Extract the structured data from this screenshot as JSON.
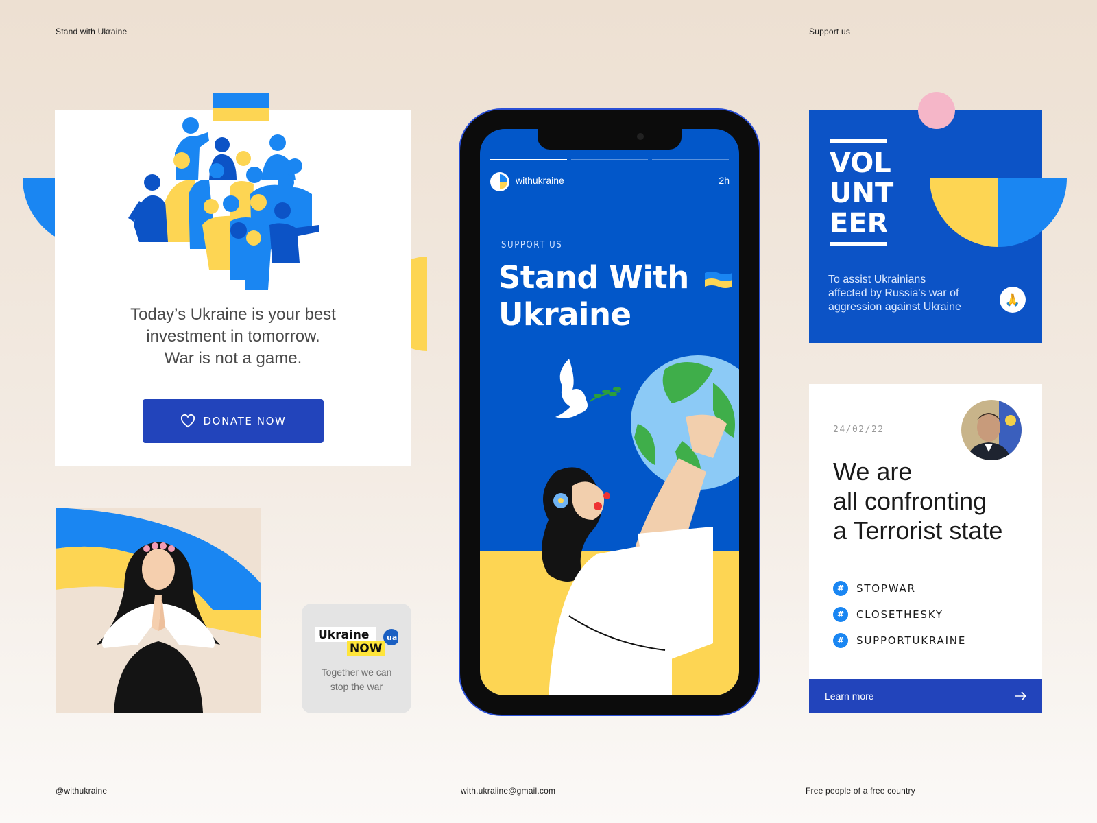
{
  "header": {
    "left": "Stand with Ukraine",
    "right": "Support us"
  },
  "footer": {
    "handle": "@withukraine",
    "email": "with.ukraiine@gmail.com",
    "motto": "Free people of a free country"
  },
  "donate_card": {
    "line1": "Today’s Ukraine is your best",
    "line2": "investment in tomorrow.",
    "line3": "War is not a game.",
    "button_label": "DONATE NOW"
  },
  "now_card": {
    "logo_word1": "Ukraine",
    "logo_word2": "NOW",
    "logo_badge": "ua",
    "line1": "Together we can",
    "line2": "stop the war"
  },
  "story": {
    "username": "withukraine",
    "time": "2h",
    "eyebrow": "SUPPORT US",
    "title_line1": "Stand With",
    "title_line2": "Ukraine"
  },
  "volunteer_card": {
    "word1": "VOL",
    "word2": "UNT",
    "word3": "EER",
    "desc1": "To assist Ukrainians",
    "desc2": "affected by Russia's war of",
    "desc3": "aggression against Ukraine",
    "button_icon": "🙏"
  },
  "news_card": {
    "date": "24/02/22",
    "title1": "We are",
    "title2": "all confronting",
    "title3": "a Terrorist state",
    "tags": [
      {
        "hash": "#",
        "label": "STOPWAR"
      },
      {
        "hash": "#",
        "label": "CLOSETHESKY"
      },
      {
        "hash": "#",
        "label": "SUPPORTUKRAINE"
      }
    ],
    "cta": "Learn more"
  },
  "colors": {
    "blue": "#0c53c6",
    "royal": "#2244bb",
    "yellow": "#fdd553",
    "sky": "#1a86f2",
    "pink": "#f5b6c8"
  }
}
